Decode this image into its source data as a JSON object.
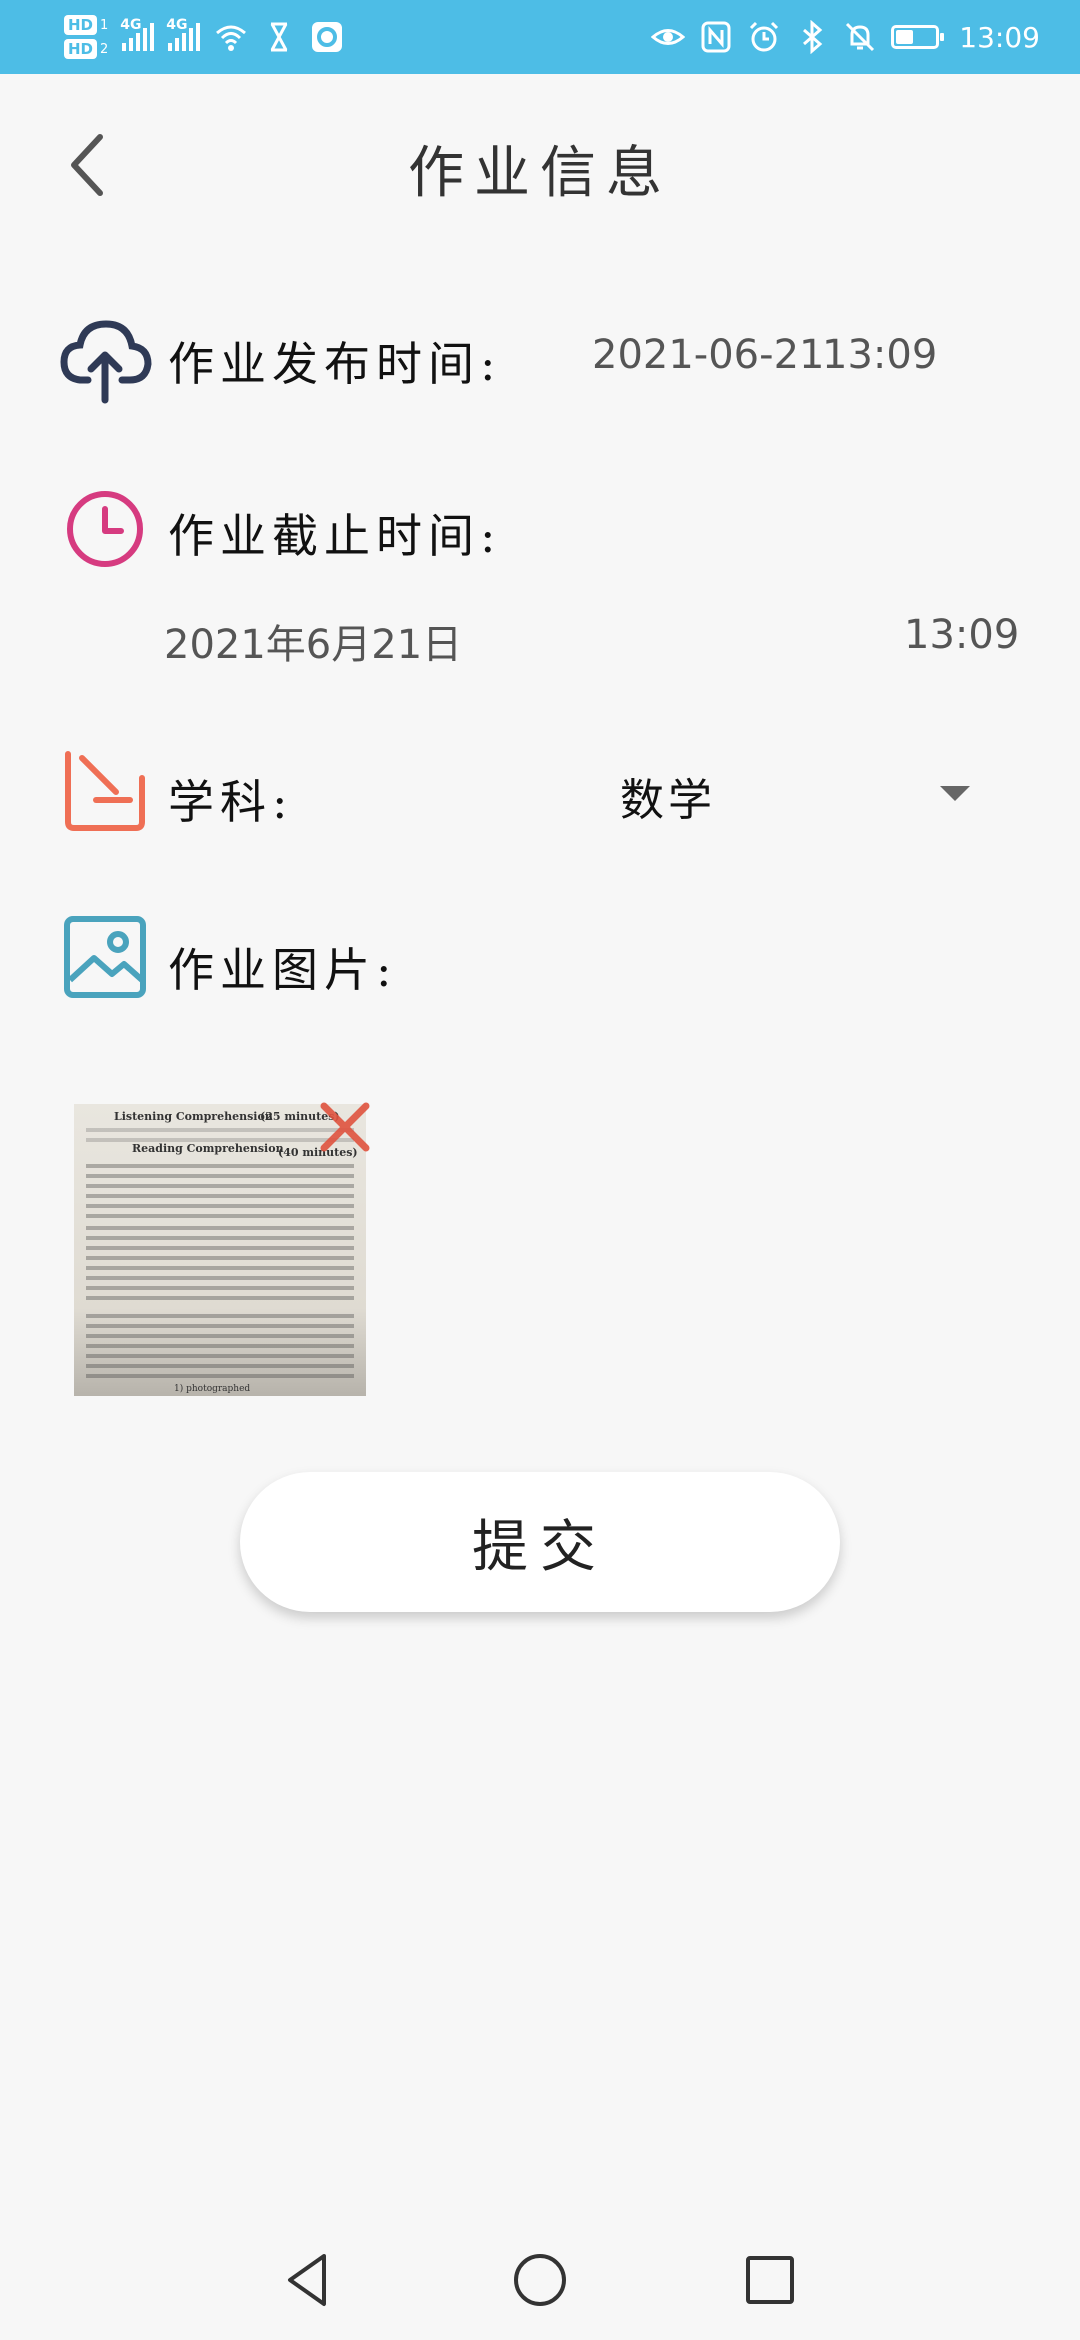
{
  "status_bar": {
    "left": {
      "hd1": "HD",
      "hd1_num": "1",
      "hd2": "HD",
      "hd2_num": "2",
      "net1": "4G",
      "net2": "4G"
    },
    "time": "13:09",
    "battery_level": 0.45,
    "icons": [
      "eye-icon",
      "nfc-icon",
      "alarm-icon",
      "bluetooth-icon",
      "mute-icon",
      "battery-icon"
    ]
  },
  "header": {
    "title": "作业信息"
  },
  "publish": {
    "label": "作业发布时间:",
    "date": "2021-06-21",
    "time": "13:09"
  },
  "deadline": {
    "label": "作业截止时间:",
    "date": "2021年6月21日",
    "time": "13:09"
  },
  "subject": {
    "label": "学科:",
    "value": "数学"
  },
  "images": {
    "label": "作业图片:",
    "thumb_texts": {
      "heading1": "Listening Comprehension",
      "heading1_right": "(25 minutes)",
      "heading2": "Reading Comprehension",
      "heading2_right": "(40 minutes)",
      "footer": "1)  photographed"
    }
  },
  "submit": {
    "label": "提交"
  },
  "colors": {
    "status_bar": "#4dbde6",
    "publish_icon": "#2f3a56",
    "deadline_icon": "#d63b80",
    "subject_icon": "#ef6f55",
    "image_icon": "#4aa3bd",
    "delete_icon": "#e0533f"
  }
}
